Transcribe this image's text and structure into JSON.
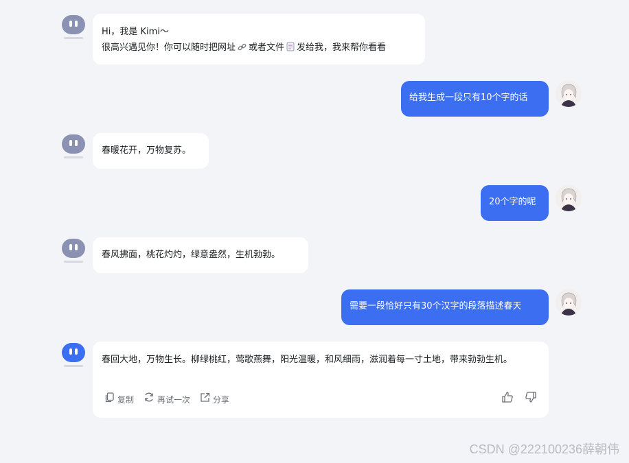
{
  "messages": [
    {
      "role": "bot",
      "line1": "Hi，我是 Kimi～",
      "line2_a": "很高兴遇见你！你可以随时把网址",
      "line2_b": "或者文件",
      "line2_c": "发给我，我来帮你看看"
    },
    {
      "role": "user",
      "text": "给我生成一段只有10个字的话"
    },
    {
      "role": "bot",
      "text": "春暖花开，万物复苏。"
    },
    {
      "role": "user",
      "text": "20个字的呢"
    },
    {
      "role": "bot",
      "text": "春风拂面，桃花灼灼，绿意盎然，生机勃勃。"
    },
    {
      "role": "user",
      "text": "需要一段恰好只有30个汉字的段落描述春天"
    },
    {
      "role": "bot",
      "text": "春回大地，万物生长。柳绿桃红，莺歌燕舞，阳光温暖，和风细雨，滋润着每一寸土地，带来勃勃生机。"
    }
  ],
  "actions": {
    "copy_label": "复制",
    "retry_label": "再试一次",
    "share_label": "分享"
  },
  "icons": {
    "link": "link-icon",
    "file": "file-icon",
    "copy": "copy-icon",
    "retry": "refresh-icon",
    "share": "share-icon",
    "like": "thumbs-up-icon",
    "dislike": "thumbs-down-icon"
  },
  "colors": {
    "accent": "#3b6ef0",
    "bot_avatar": "#8b91b3",
    "background": "#f3f4f8"
  },
  "watermark": "CSDN @222100236薛朝伟"
}
